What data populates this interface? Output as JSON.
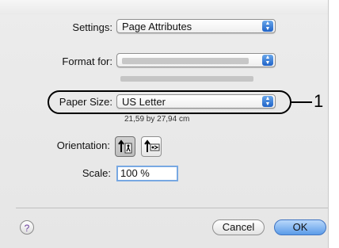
{
  "settings": {
    "label": "Settings:",
    "value": "Page Attributes"
  },
  "format_for": {
    "label": "Format for:"
  },
  "paper_size": {
    "label": "Paper Size:",
    "value": "US Letter",
    "dimensions": "21,59 by 27,94 cm"
  },
  "callout": "1",
  "orientation": {
    "label": "Orientation:"
  },
  "scale": {
    "label": "Scale:",
    "value": "100 %"
  },
  "help": "?",
  "buttons": {
    "cancel": "Cancel",
    "ok": "OK"
  }
}
